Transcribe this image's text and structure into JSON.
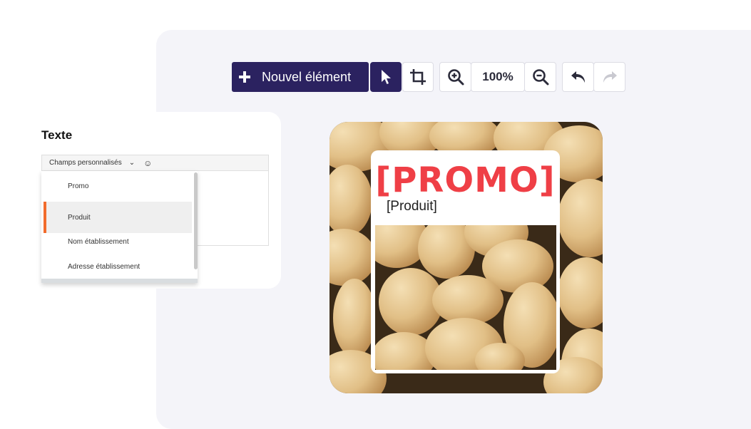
{
  "toolbar": {
    "new_element_label": "Nouvel élément",
    "zoom_value": "100%"
  },
  "panel": {
    "title": "Texte",
    "custom_fields_label": "Champs personnalisés",
    "dropdown_items": [
      "Promo",
      "Produit",
      "Nom établissement",
      "Adresse établissement"
    ],
    "selected_item": "Produit"
  },
  "poster": {
    "promo_text": "[PROMO]",
    "product_text": "[Produit]"
  },
  "colors": {
    "primary": "#2b2260",
    "accent": "#f26b2c",
    "promo": "#ef3f46"
  }
}
